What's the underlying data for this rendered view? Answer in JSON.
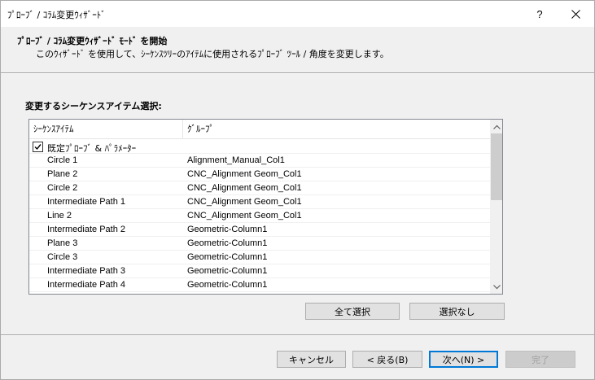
{
  "window": {
    "title": "ﾌﾟﾛｰﾌﾞ / ｺﾗﾑ変更ｳｨｻﾞｰﾄﾞ",
    "help_label": "?"
  },
  "header": {
    "title": "ﾌﾟﾛｰﾌﾞ / ｺﾗﾑ変更ｳｨｻﾞｰﾄﾞ ﾓｰﾄﾞ を開始",
    "subtitle": "このｳｨｻﾞｰﾄﾞ を使用して、ｼｰｹﾝｽﾂﾘｰのｱｲﾃﾑに使用されるﾌﾟﾛｰﾌﾞ ﾂｰﾙ / 角度を変更します。"
  },
  "selection": {
    "label": "変更するシーケンスアイテム選択:",
    "columns": [
      "ｼｰｹﾝｽｱｲﾃﾑ",
      "ｸﾞﾙｰﾌﾟ"
    ],
    "group_row": {
      "label": "既定ﾌﾟﾛｰﾌﾞ & ﾊﾟﾗﾒｰﾀｰ",
      "checked": true
    },
    "rows": [
      {
        "item": "Circle 1",
        "group": "Alignment_Manual_Col1"
      },
      {
        "item": "Plane 2",
        "group": "CNC_Alignment Geom_Col1"
      },
      {
        "item": "Circle 2",
        "group": "CNC_Alignment Geom_Col1"
      },
      {
        "item": "Intermediate Path 1",
        "group": "CNC_Alignment Geom_Col1"
      },
      {
        "item": "Line 2",
        "group": "CNC_Alignment Geom_Col1"
      },
      {
        "item": "Intermediate Path 2",
        "group": "Geometric-Column1"
      },
      {
        "item": "Plane 3",
        "group": "Geometric-Column1"
      },
      {
        "item": "Circle 3",
        "group": "Geometric-Column1"
      },
      {
        "item": "Intermediate Path 3",
        "group": "Geometric-Column1"
      },
      {
        "item": "Intermediate Path 4",
        "group": "Geometric-Column1"
      }
    ],
    "select_all_label": "全て選択",
    "select_none_label": "選択なし"
  },
  "footer": {
    "cancel_label": "キャンセル",
    "back_label": "< 戻る(B)",
    "next_label": "次へ(N) >",
    "finish_label": "完了"
  },
  "colors": {
    "accent": "#0078d7",
    "window_bg": "#f0f0f0",
    "disabled_text": "#a0a0a0"
  }
}
